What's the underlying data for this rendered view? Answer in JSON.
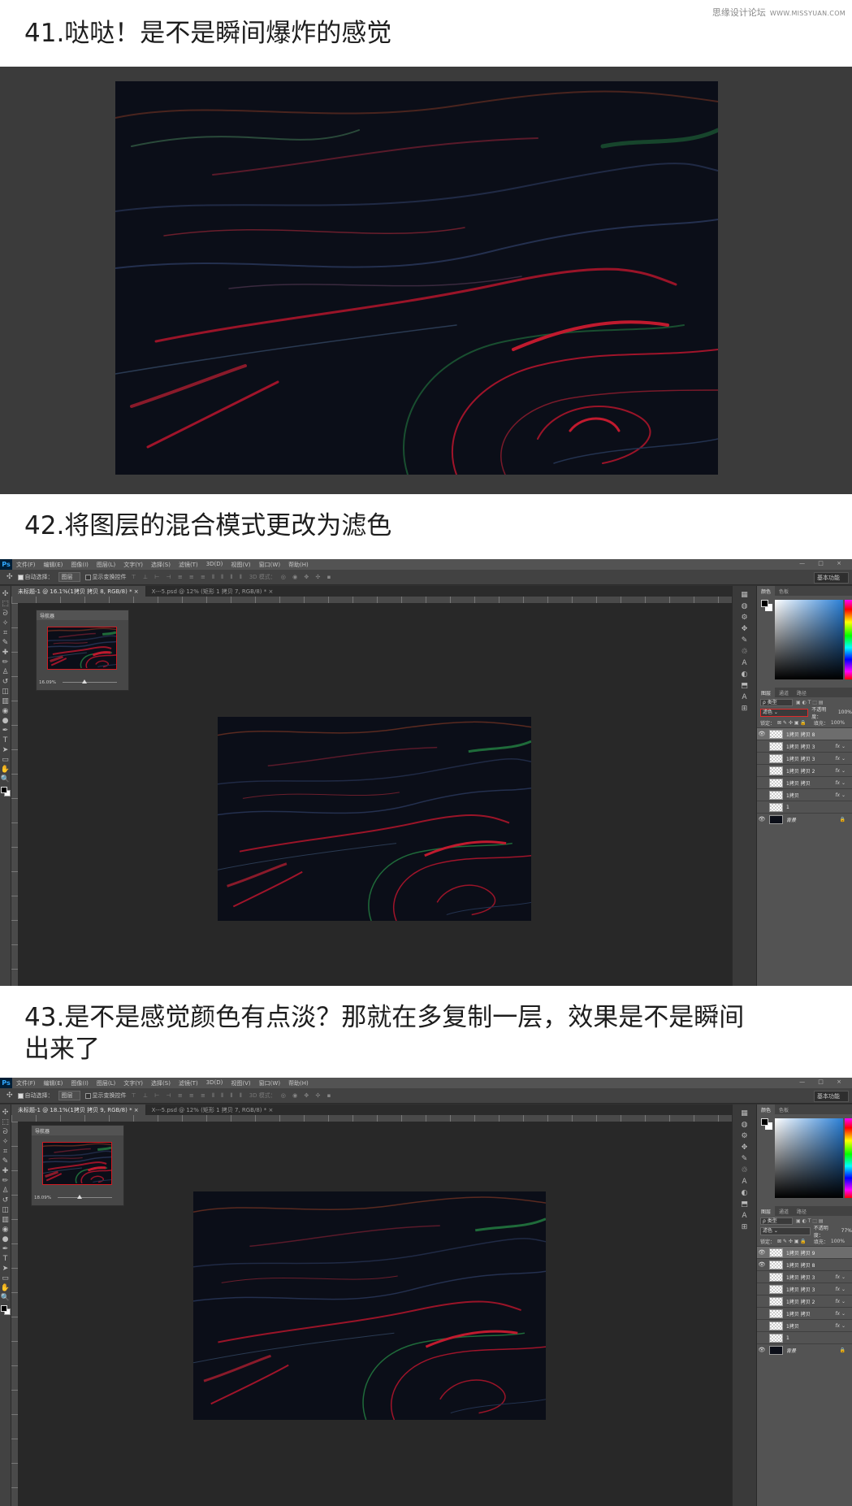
{
  "watermark": {
    "site": "思缘设计论坛",
    "url": "WWW.MISSYUAN.COM"
  },
  "steps": [
    {
      "heading": "41.哒哒！是不是瞬间爆炸的感觉"
    },
    {
      "heading": "42.将图层的混合模式更改为滤色"
    },
    {
      "heading_line1": "43.是不是感觉颜色有点淡？那就在多复制一层，效果是不是瞬间",
      "heading_line2": "出来了"
    }
  ],
  "ps": {
    "logo": "Ps",
    "menu": [
      "文件(F)",
      "编辑(E)",
      "图像(I)",
      "图层(L)",
      "文字(Y)",
      "选择(S)",
      "滤镜(T)",
      "3D(D)",
      "视图(V)",
      "窗口(W)",
      "帮助(H)"
    ],
    "window_controls": "— □ ×",
    "options": {
      "auto_select": "自动选择：",
      "auto_select_target": "图层",
      "show_transform": "显示变换控件",
      "mode_3d": "3D 模式：",
      "workspace": "基本功能"
    },
    "navigator_title": "导航器",
    "color_tabs": [
      "颜色",
      "色板"
    ],
    "layer_tabs": [
      "图层",
      "通道",
      "路径"
    ],
    "filter_kind": "ρ 类型",
    "lock_label": "锁定：",
    "lock_icons": "⊠ ✎ ✣ ▣ 🔒",
    "opacity_label": "不透明度：",
    "fill_label": "填充：",
    "window1": {
      "tabs": [
        "未标题-1 @ 16.1%(1拷贝 拷贝 8, RGB/8) *",
        "X---5.psd @ 12% (矩形 1 拷贝 7, RGB/8) *"
      ],
      "zoom": "16.09%",
      "blend_mode": "滤色",
      "opacity": "100%",
      "fill": "100%",
      "layers": [
        {
          "name": "1拷贝 拷贝 8",
          "visible": true,
          "selected": true,
          "fx": false,
          "thumb": "transparent"
        },
        {
          "name": "1拷贝 拷贝 3",
          "visible": false,
          "selected": false,
          "fx": true,
          "thumb": "transparent"
        },
        {
          "name": "1拷贝 拷贝 3",
          "visible": false,
          "selected": false,
          "fx": true,
          "thumb": "transparent"
        },
        {
          "name": "1拷贝 拷贝 2",
          "visible": false,
          "selected": false,
          "fx": true,
          "thumb": "transparent"
        },
        {
          "name": "1拷贝 拷贝",
          "visible": false,
          "selected": false,
          "fx": true,
          "thumb": "transparent"
        },
        {
          "name": "1拷贝",
          "visible": false,
          "selected": false,
          "fx": true,
          "thumb": "transparent"
        },
        {
          "name": "1",
          "visible": false,
          "selected": false,
          "fx": false,
          "thumb": "transparent"
        },
        {
          "name": "背景",
          "visible": true,
          "selected": false,
          "fx": false,
          "thumb": "dark",
          "locked": true
        }
      ]
    },
    "window2": {
      "tabs": [
        "未标题-1 @ 18.1%(1拷贝 拷贝 9, RGB/8) *",
        "X---5.psd @ 12% (矩形 1 拷贝 7, RGB/8) *"
      ],
      "zoom": "18.09%",
      "blend_mode": "滤色",
      "opacity": "77%",
      "fill": "100%",
      "layers": [
        {
          "name": "1拷贝 拷贝 9",
          "visible": true,
          "selected": true,
          "fx": false,
          "thumb": "transparent"
        },
        {
          "name": "1拷贝 拷贝 8",
          "visible": true,
          "selected": false,
          "fx": false,
          "thumb": "transparent"
        },
        {
          "name": "1拷贝 拷贝 3",
          "visible": false,
          "selected": false,
          "fx": true,
          "thumb": "transparent"
        },
        {
          "name": "1拷贝 拷贝 3",
          "visible": false,
          "selected": false,
          "fx": true,
          "thumb": "transparent"
        },
        {
          "name": "1拷贝 拷贝 2",
          "visible": false,
          "selected": false,
          "fx": true,
          "thumb": "transparent"
        },
        {
          "name": "1拷贝 拷贝",
          "visible": false,
          "selected": false,
          "fx": true,
          "thumb": "transparent"
        },
        {
          "name": "1拷贝",
          "visible": false,
          "selected": false,
          "fx": true,
          "thumb": "transparent"
        },
        {
          "name": "1",
          "visible": false,
          "selected": false,
          "fx": false,
          "thumb": "transparent"
        },
        {
          "name": "背景",
          "visible": true,
          "selected": false,
          "fx": false,
          "thumb": "dark",
          "locked": true
        }
      ]
    },
    "fx_label": "fx",
    "tools_icons": [
      "move-icon",
      "marquee-icon",
      "lasso-icon",
      "magic-wand-icon",
      "crop-icon",
      "eyedropper-icon",
      "healing-icon",
      "brush-icon",
      "stamp-icon",
      "history-brush-icon",
      "eraser-icon",
      "gradient-icon",
      "blur-icon",
      "dodge-icon",
      "pen-icon",
      "type-icon",
      "path-select-icon",
      "rectangle-icon",
      "hand-icon",
      "zoom-icon"
    ],
    "tools_glyphs": [
      "✣",
      "⬚",
      "ᘐ",
      "✧",
      "⌗",
      "✎",
      "✚",
      "✏",
      "♙",
      "↺",
      "◫",
      "▥",
      "◉",
      "●",
      "✒",
      "T",
      "➤",
      "▭",
      "✋",
      "🔍"
    ],
    "strip_glyphs": [
      "▦",
      "◍",
      "⚙",
      "✥",
      "✎",
      "♲",
      "A",
      "◐",
      "⬒",
      "A",
      "⊞"
    ]
  },
  "colors": {
    "accent_red": "#d01c22",
    "canvas_bg": "#0b0e18",
    "swirl_red": "#b0122c",
    "swirl_green": "#1f6b3a"
  }
}
